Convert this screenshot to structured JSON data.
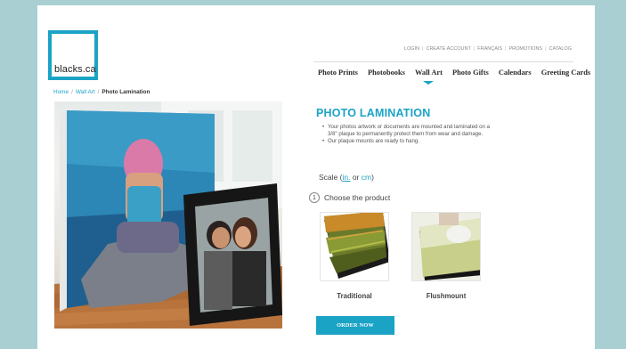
{
  "brand": {
    "logo_text": "blacks.ca",
    "accent": "#1ba3c6"
  },
  "top_links": [
    "LOGIN",
    "CREATE ACCOUNT",
    "FRANÇAIS",
    "PROMOTIONS",
    "CATALOG"
  ],
  "main_nav": [
    {
      "label": "Photo Prints",
      "active": false
    },
    {
      "label": "Photobooks",
      "active": false
    },
    {
      "label": "Wall Art",
      "active": true
    },
    {
      "label": "Photo Gifts",
      "active": false
    },
    {
      "label": "Calendars",
      "active": false
    },
    {
      "label": "Greeting Cards",
      "active": false
    }
  ],
  "breadcrumb": {
    "home": "Home",
    "section": "Wall Art",
    "current": "Photo Lamination",
    "separator": "/"
  },
  "product": {
    "title": "PHOTO LAMINATION",
    "bullets": [
      "Your photos artwork or documents are mounted and laminated on a 3/8\" plaque to permanently protect them from wear and damage.",
      "Our plaque mounts are ready to hang."
    ]
  },
  "scale": {
    "prefix": "Scale (",
    "unit_in": "in.",
    "middle": " or ",
    "unit_cm": "cm",
    "suffix": ")",
    "selected": "in."
  },
  "step1": {
    "number": "1",
    "label": "Choose the product"
  },
  "options": [
    {
      "label": "Traditional",
      "icon": "traditional-plaque-image"
    },
    {
      "label": "Flushmount",
      "icon": "flushmount-plaque-image"
    }
  ],
  "order_button": {
    "label": "ORDER NOW"
  }
}
